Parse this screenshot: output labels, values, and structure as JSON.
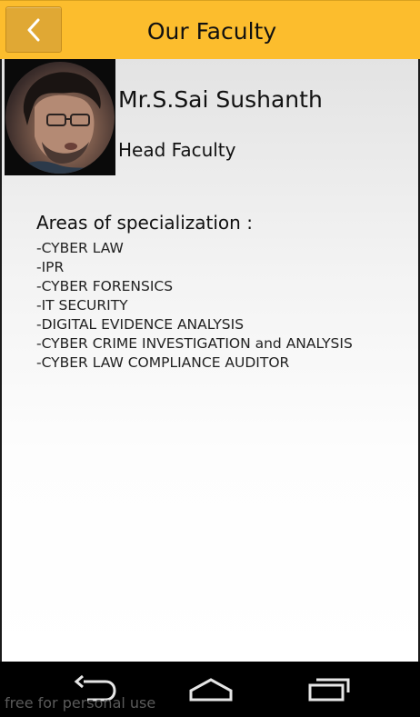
{
  "app_bar": {
    "title": "Our Faculty",
    "back_icon": "chevron-left-icon",
    "background_color": "#fcbd2d"
  },
  "faculty": {
    "name": "Mr.S.Sai Sushanth",
    "role": "Head Faculty",
    "specialization_heading": "Areas of specialization :",
    "specializations": [
      "-CYBER LAW",
      "-IPR",
      "-CYBER FORENSICS",
      "-IT SECURITY",
      "-DIGITAL EVIDENCE ANALYSIS",
      "-CYBER CRIME INVESTIGATION and ANALYSIS",
      "-CYBER LAW COMPLIANCE AUDITOR"
    ]
  },
  "nav_bar": {
    "back_icon": "back-arrow-icon",
    "home_icon": "home-icon",
    "recents_icon": "recent-apps-icon"
  },
  "watermark": "free for personal use"
}
